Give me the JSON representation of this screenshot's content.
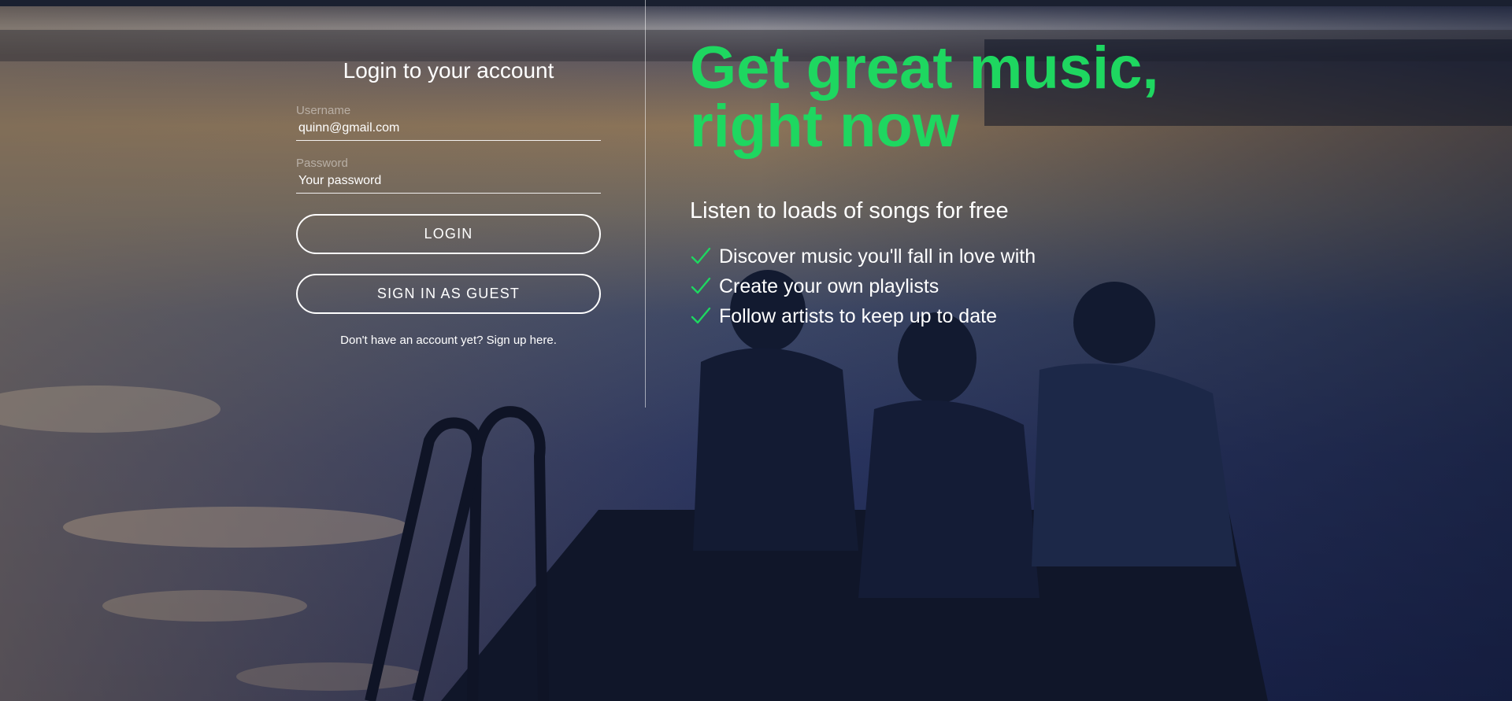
{
  "colors": {
    "accent": "#1ed760",
    "text": "#ffffff",
    "muted_label": "rgba(255,255,255,0.45)"
  },
  "login": {
    "title": "Login to your account",
    "username_label": "Username",
    "username_value": "quinn@gmail.com",
    "password_label": "Password",
    "password_placeholder": "Your password",
    "login_button": "LOGIN",
    "guest_button": "SIGN IN AS GUEST",
    "signup_text": "Don't have an account yet? Sign up here."
  },
  "promo": {
    "headline_line1": "Get great music,",
    "headline_line2": "right now",
    "subheading": "Listen to loads of songs for free",
    "features": [
      "Discover music you'll fall in love with",
      "Create your own playlists",
      "Follow artists to keep up to date"
    ],
    "check_icon": "checkmark-icon"
  },
  "background": {
    "description_icon": "lake-dock-background-image"
  }
}
